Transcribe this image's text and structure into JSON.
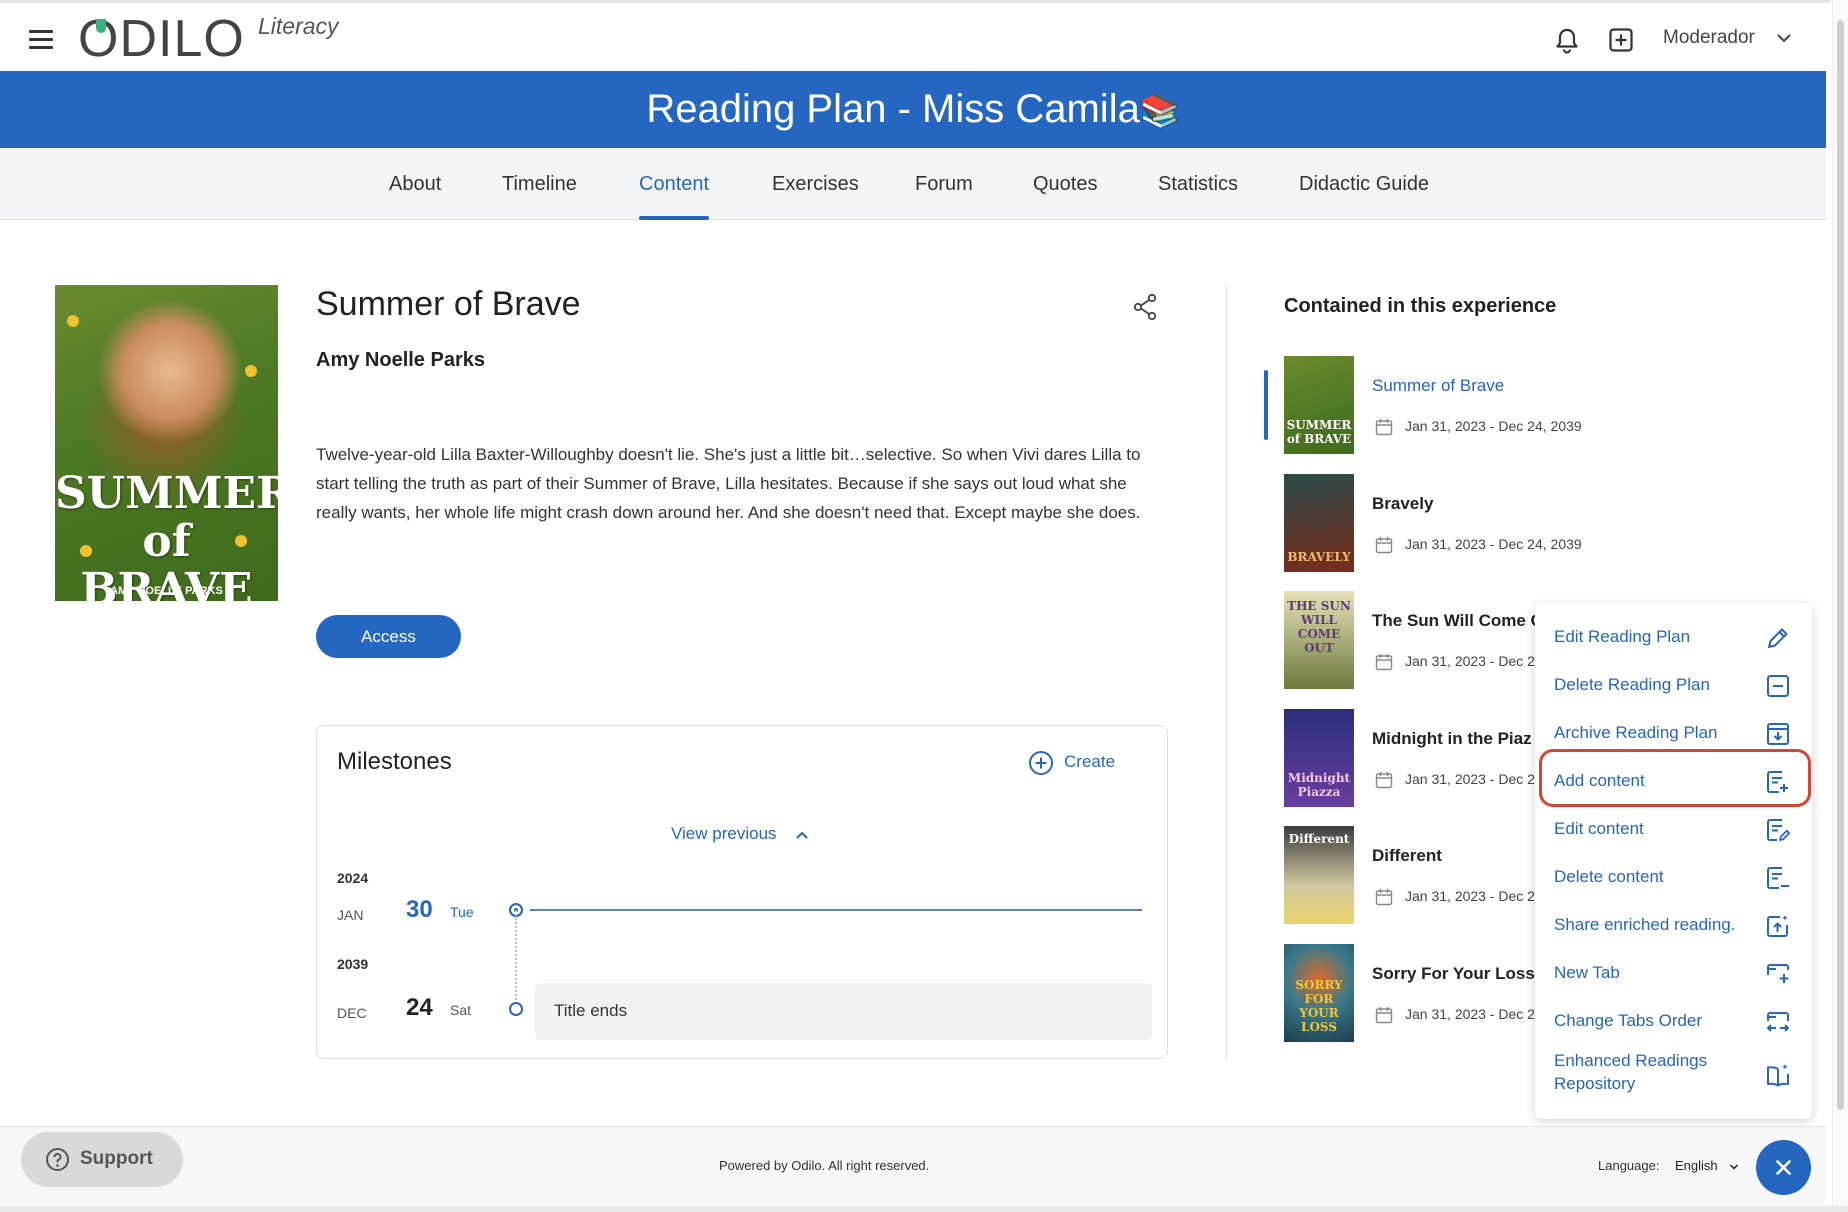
{
  "app": {
    "logo_text": "ODILO",
    "logo_sub": "Literacy",
    "user": "Moderador"
  },
  "banner": {
    "title": "Reading Plan - Miss Camila",
    "emoji": "📚"
  },
  "tabs": [
    "About",
    "Timeline",
    "Content",
    "Exercises",
    "Forum",
    "Quotes",
    "Statistics",
    "Didactic Guide"
  ],
  "active_tab": "Content",
  "book": {
    "cover_title": "SUMMER of BRAVE",
    "cover_author": "AMY NOELLE PARKS",
    "title": "Summer of Brave",
    "author": "Amy Noelle Parks",
    "description": "Twelve-year-old Lilla Baxter-Willoughby doesn't lie. She's just a little bit…selective. So when Vivi dares Lilla to start telling the truth as part of their Summer of Brave, Lilla hesitates. Because if she says out loud what she really wants, her whole life might crash down around her. And she doesn't need that. Except maybe she does.",
    "access_label": "Access"
  },
  "milestones": {
    "title": "Milestones",
    "create_label": "Create",
    "view_previous": "View previous",
    "entries": [
      {
        "year": "2024",
        "month": "JAN",
        "day": "30",
        "dow": "Tue"
      },
      {
        "year": "2039",
        "month": "DEC",
        "day": "24",
        "dow": "Sat",
        "event": "Title ends"
      }
    ]
  },
  "contained": {
    "title": "Contained in this experience",
    "items": [
      {
        "name": "Summer of Brave",
        "date": "Jan 31, 2023 - Dec 24, 2039",
        "thumb": "SUMMER of BRAVE"
      },
      {
        "name": "Bravely",
        "date": "Jan 31, 2023 - Dec 24, 2039",
        "thumb": "BRAVELY"
      },
      {
        "name": "The Sun Will Come O",
        "date": "Jan 31, 2023 - Dec 2",
        "thumb": "THE SUN WILL COME OUT"
      },
      {
        "name": "Midnight in the Piaz",
        "date": "Jan 31, 2023 - Dec 2",
        "thumb": "Midnight Piazza"
      },
      {
        "name": "Different",
        "date": "Jan 31, 2023 - Dec 2",
        "thumb": "Different"
      },
      {
        "name": "Sorry For Your Loss",
        "date": "Jan 31, 2023 - Dec 2",
        "thumb": "SORRY FOR YOUR LOSS"
      }
    ]
  },
  "menu": {
    "items": [
      {
        "label": "Edit Reading Plan",
        "icon": "pencil-icon"
      },
      {
        "label": "Delete Reading Plan",
        "icon": "minus-box-icon"
      },
      {
        "label": "Archive Reading Plan",
        "icon": "archive-icon"
      },
      {
        "label": "Add content",
        "icon": "add-content-icon"
      },
      {
        "label": "Edit content",
        "icon": "edit-content-icon"
      },
      {
        "label": "Delete content",
        "icon": "delete-content-icon"
      },
      {
        "label": "Share enriched reading.",
        "icon": "share-enriched-icon"
      },
      {
        "label": "New Tab",
        "icon": "new-tab-icon"
      },
      {
        "label": "Change Tabs Order",
        "icon": "tabs-order-icon"
      },
      {
        "label": "Enhanced Readings Repository",
        "icon": "book-sparkle-icon"
      }
    ],
    "highlighted": "Add content"
  },
  "footer": {
    "support": "Support",
    "powered": "Powered by Odilo. All right reserved.",
    "language_label": "Language:",
    "language_value": "English"
  },
  "colors": {
    "accent": "#2566c0",
    "highlight": "#d84430"
  }
}
